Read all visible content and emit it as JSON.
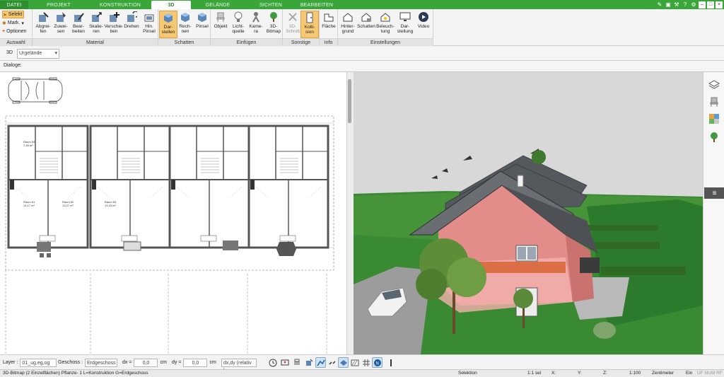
{
  "menu": {
    "tabs": [
      "DATEI",
      "PROJEKT",
      "KONSTRUKTION",
      "3D",
      "GELÄNDE",
      "SICHTEN",
      "BEARBEITEN"
    ],
    "active_tab": "3D"
  },
  "window": {
    "min": "–",
    "max": "□",
    "close": "×"
  },
  "ribbon": {
    "auswahl": {
      "select": "Selekt",
      "mark": "Mark.",
      "options": "Optionen",
      "label": "Auswahl"
    },
    "material": {
      "label": "Material",
      "buttons": [
        "Abgrei-\nfen",
        "Zuwei-\nsen",
        "Bear-\nbeiten",
        "Skalie-\nren",
        "Verschie-\nben",
        "Drehen",
        "Hin.\nPinsel"
      ]
    },
    "schatten": {
      "label": "Schatten",
      "buttons": [
        "Dar-\nstellen",
        "Rech-\nnen",
        "Pinsel"
      ]
    },
    "einfuegen": {
      "label": "Einfügen",
      "buttons": [
        "Objekt",
        "Licht-\nquelle",
        "Kame-\nra",
        "3D-\nBitmap"
      ]
    },
    "sonstige": {
      "label": "Sonstige",
      "buttons": [
        "3D-\nSchnitt",
        "Kolli-\nsion"
      ]
    },
    "info": {
      "label": "Info",
      "buttons": [
        "Fläche"
      ]
    },
    "einstellungen": {
      "label": "Einstellungen",
      "buttons": [
        "Hinter-\ngrund",
        "Schatten",
        "Beleuch-\ntung",
        "Dar-\nstellung",
        "Video"
      ]
    }
  },
  "viewbar": {
    "mode": "3D",
    "terrain_select": "Urgelände"
  },
  "dialog": {
    "label": "Dialoge:"
  },
  "plan": {
    "rooms_big": [
      "Raum 61",
      "Raum 62",
      "Raum 63"
    ],
    "area_a": "14,17 m²",
    "area_b": "13,27 m²",
    "area_c": "13,15 m²",
    "room_small": "Raum 54",
    "area_small": "7,45 m²"
  },
  "bottom": {
    "layer_label": "Layer :",
    "layer_value": "01_ug,eg,og",
    "geschoss_label": "Geschoss :",
    "geschoss_value": "Erdgeschoss",
    "dx_label": "dx =",
    "dx_value": "0,0",
    "dx_unit": "cm",
    "dy_label": "dy =",
    "dy_value": "0,0",
    "dy_unit": "cm",
    "mode_value": "dx,dy (relativ ka"
  },
  "status": {
    "info": "3D-Bitmap (2 Einzelflächen) Pflanze- 1 L=Konstruktion G=Erdgeschoss",
    "mode": "Selektion",
    "scale_sel": "1:1 sel",
    "x": "X:",
    "y": "Y:",
    "z": "Z:",
    "scale": "1:100",
    "unit": "Zentimeter",
    "ein": "Ein",
    "flags": "UF NUM RF"
  },
  "colors": {
    "menu": "#3aa63a",
    "accent": "#f7c873",
    "grass": "#2f7d2a",
    "facade": "#e79090",
    "roof": "#5f6266"
  }
}
